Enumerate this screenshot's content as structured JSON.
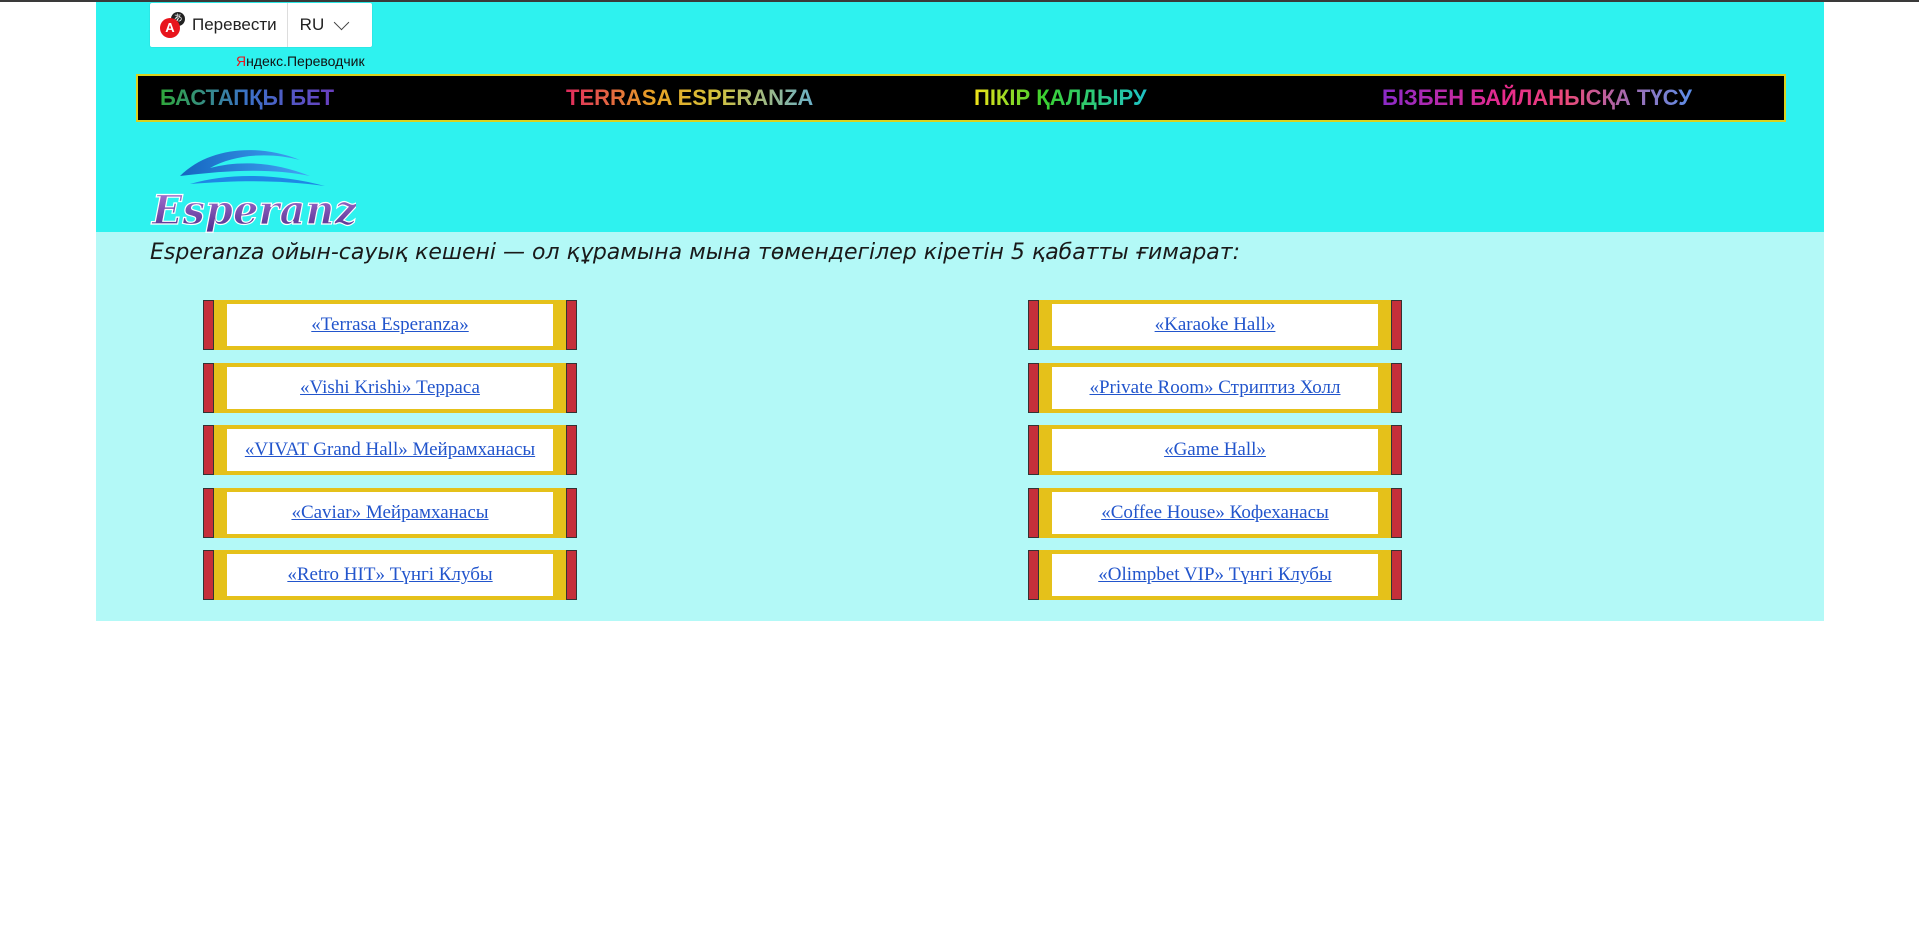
{
  "translate_widget": {
    "label": "Перевести",
    "lang": "RU",
    "brand_prefix": "Я",
    "brand_rest": "ндекс.Переводчик"
  },
  "nav": [
    {
      "label": "БАСТАПҚЫ БЕТ"
    },
    {
      "label": "TERRASA ESPERANZA"
    },
    {
      "label": "ПІКІР ҚАЛДЫРУ"
    },
    {
      "label": "БІЗБЕН БАЙЛАНЫСҚА ТҮСУ"
    }
  ],
  "logo_text": "Esperanza",
  "intro": "Esperanza ойын-сауық кешені — ол құрамына мына төмендегілер кіретін 5 қабатты ғимарат:",
  "venues_left": [
    {
      "label": "«Terrasa Esperanza»"
    },
    {
      "label": "«Vishi Krishi» Терраса"
    },
    {
      "label": "«VIVAT Grand Hall» Мейрамханасы"
    },
    {
      "label": "«Caviar» Мейрамханасы"
    },
    {
      "label": "«Retro HIT» Түнгі Клубы"
    }
  ],
  "venues_right": [
    {
      "label": "«Karaoke Hall»"
    },
    {
      "label": "«Private Room» Стриптиз Холл"
    },
    {
      "label": "«Game Hall»"
    },
    {
      "label": "«Coffee House» Кофеханасы"
    },
    {
      "label": "«Olimpbet VIP» Түнгі Клубы"
    }
  ],
  "colors": {
    "header_bg": "#2ef2ef",
    "content_bg": "#b3f9f7",
    "nav_bg": "#000000",
    "button_gold": "#e5c11a",
    "button_red": "#c52f3a",
    "link": "#2255cc"
  }
}
